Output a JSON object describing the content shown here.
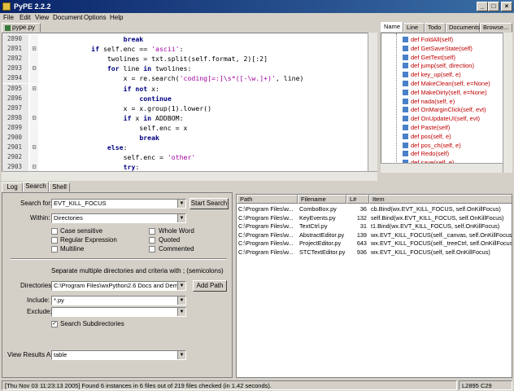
{
  "window": {
    "title": "PyPE 2.2.2",
    "min_glyph": "_",
    "max_glyph": "□",
    "close_glyph": "×"
  },
  "menu": [
    "File",
    "Edit",
    "View",
    "Document",
    "Options",
    "Help"
  ],
  "file_tab": "pype.py",
  "editor": {
    "lines": [
      {
        "n": "2890",
        "fold": "",
        "code": "                    break"
      },
      {
        "n": "2891",
        "fold": "⊟",
        "code": "            if self.enc == 'ascii':"
      },
      {
        "n": "2892",
        "fold": "",
        "code": "                twolines = txt.split(self.format, 2)[:2]"
      },
      {
        "n": "2893",
        "fold": "⊟",
        "code": "                for line in twolines:"
      },
      {
        "n": "2894",
        "fold": "",
        "code": "                    x = re.search('coding[=:]\\s*([-\\w.]+)', line)"
      },
      {
        "n": "2895",
        "fold": "⊟",
        "code": "                    if not x:"
      },
      {
        "n": "2896",
        "fold": "",
        "code": "                        continue"
      },
      {
        "n": "2897",
        "fold": "",
        "code": "                    x = x.group(1).lower()"
      },
      {
        "n": "2898",
        "fold": "⊟",
        "code": "                    if x in ADDBOM:"
      },
      {
        "n": "2899",
        "fold": "",
        "code": "                        self.enc = x"
      },
      {
        "n": "2900",
        "fold": "",
        "code": "                        break"
      },
      {
        "n": "2901",
        "fold": "⊟",
        "code": "                else:"
      },
      {
        "n": "2902",
        "fold": "",
        "code": "                    self.enc = 'other'"
      },
      {
        "n": "2903",
        "fold": "⊟",
        "code": "                    try:"
      },
      {
        "n": "2904",
        "fold": "",
        "code": "                        txt = txt.decode(x)"
      }
    ]
  },
  "right_tabs": [
    "Name",
    "Line",
    "Todo",
    "Documents",
    "Browse..."
  ],
  "functions": [
    "def FoldAll(self)",
    "def GetSaveState(self)",
    "def GetText(self)",
    "def jump(self, direction)",
    "def key_up(self, e)",
    "def MakeClean(self, e=None)",
    "def MakeDirty(self, e=None)",
    "def nada(self, e)",
    "def OnMarginClick(self, evt)",
    "def OnUpdateUI(self, evt)",
    "def Paste(self)",
    "def pos(self, e)",
    "def pos_ch(self, e)",
    "def Redo(self)",
    "def save(self, e)",
    "def savel(self, e)"
  ],
  "bottom_tabs": [
    "Log",
    "Search",
    "Shell"
  ],
  "search": {
    "search_for_label": "Search for:",
    "search_for_value": "EVT_KILL_FOCUS",
    "start_button": "Start Search",
    "within_label": "Within:",
    "within_value": "Directories",
    "options": [
      {
        "label": "Case sensitive",
        "checked": false
      },
      {
        "label": "Whole Word",
        "checked": false
      },
      {
        "label": "Regular Expression",
        "checked": false
      },
      {
        "label": "Quoted",
        "checked": false
      },
      {
        "label": "Multiline",
        "checked": false
      },
      {
        "label": "Commented",
        "checked": false
      }
    ],
    "hint": "Separate multiple directories and criteria with ; (semicolons)",
    "directories_label": "Directories:",
    "directories_value": "C:\\Program Files\\wxPython2.6 Docs and Demos",
    "add_path_button": "Add Path",
    "include_label": "Include:",
    "include_value": "*.py",
    "exclude_label": "Exclude:",
    "exclude_value": "",
    "subdirs_label": "Search Subdirectories",
    "subdirs_checked": true,
    "view_label": "View Results As:",
    "view_value": "table"
  },
  "results": {
    "columns": [
      "Path",
      "Filename",
      "L#",
      "Item"
    ],
    "rows": [
      [
        "C:\\Program Files\\w...",
        "ComboBox.py",
        "36",
        "cb.Bind(wx.EVT_KILL_FOCUS, self.OnKillFocus)"
      ],
      [
        "C:\\Program Files\\w...",
        "KeyEvents.py",
        "132",
        "self.Bind(wx.EVT_KILL_FOCUS, self.OnKillFocus)"
      ],
      [
        "C:\\Program Files\\w...",
        "TextCtrl.py",
        "31",
        "t1.Bind(wx.EVT_KILL_FOCUS, self.OnKillFocus)"
      ],
      [
        "C:\\Program Files\\w...",
        "AbstractEditor.py",
        "139",
        "wx.EVT_KILL_FOCUS(self._canvas, self.OnKillFocus)"
      ],
      [
        "C:\\Program Files\\w...",
        "ProjectEditor.py",
        "643",
        "wx.EVT_KILL_FOCUS(self._treeCtrl, self.OnKillFocus)"
      ],
      [
        "C:\\Program Files\\w...",
        "STCTextEditor.py",
        "936",
        "wx.EVT_KILL_FOCUS(self, self.OnKillFocus)"
      ]
    ]
  },
  "status": {
    "message": "[Thu Nov 03 11:23:13 2005] Found 6 instances in 6 files out of 219 files checked (in 1.42 seconds).",
    "position": "L2895 C29"
  }
}
